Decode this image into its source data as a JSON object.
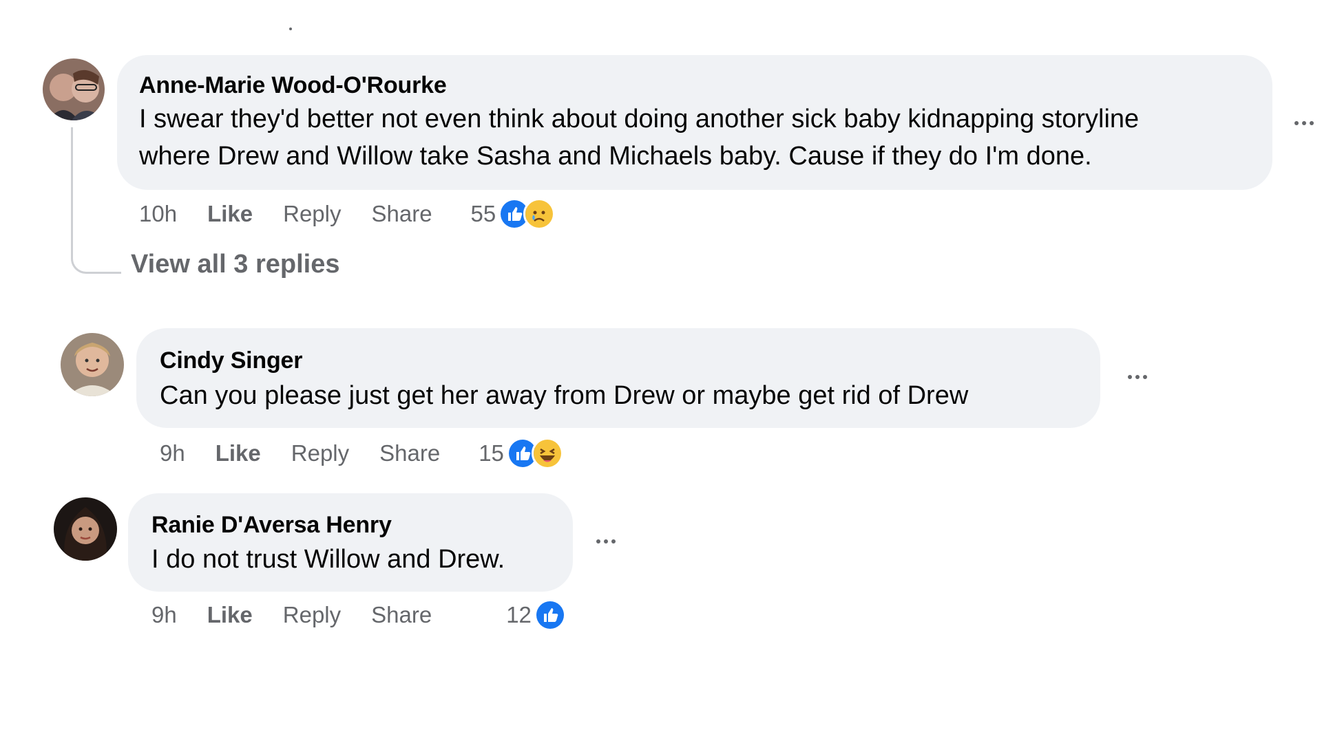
{
  "colors": {
    "bubble": "#f0f2f5",
    "meta_text": "#65676b",
    "like_blue": "#1877f2",
    "emoji_yellow": "#f7c33a"
  },
  "comments": [
    {
      "author": "Anne-Marie Wood-O'Rourke",
      "text_lines": [
        "I swear they'd better not even think about doing another sick baby kidnapping storyline",
        "where Drew and Willow take Sasha and Michaels baby. Cause if they do I'm done."
      ],
      "time": "10h",
      "like_label": "Like",
      "reply_label": "Reply",
      "share_label": "Share",
      "reaction_count": "55",
      "reactions": [
        "like-icon",
        "sad-emoji-icon"
      ],
      "view_replies": "View all 3 replies"
    },
    {
      "author": "Cindy Singer",
      "text_lines": [
        "Can you please just get her away from Drew or maybe get rid of Drew"
      ],
      "time": "9h",
      "like_label": "Like",
      "reply_label": "Reply",
      "share_label": "Share",
      "reaction_count": "15",
      "reactions": [
        "like-icon",
        "haha-emoji-icon"
      ]
    },
    {
      "author": "Ranie D'Aversa Henry",
      "text_lines": [
        "I do not trust Willow and Drew."
      ],
      "time": "9h",
      "like_label": "Like",
      "reply_label": "Reply",
      "share_label": "Share",
      "reaction_count": "12",
      "reactions": [
        "like-icon"
      ]
    }
  ]
}
